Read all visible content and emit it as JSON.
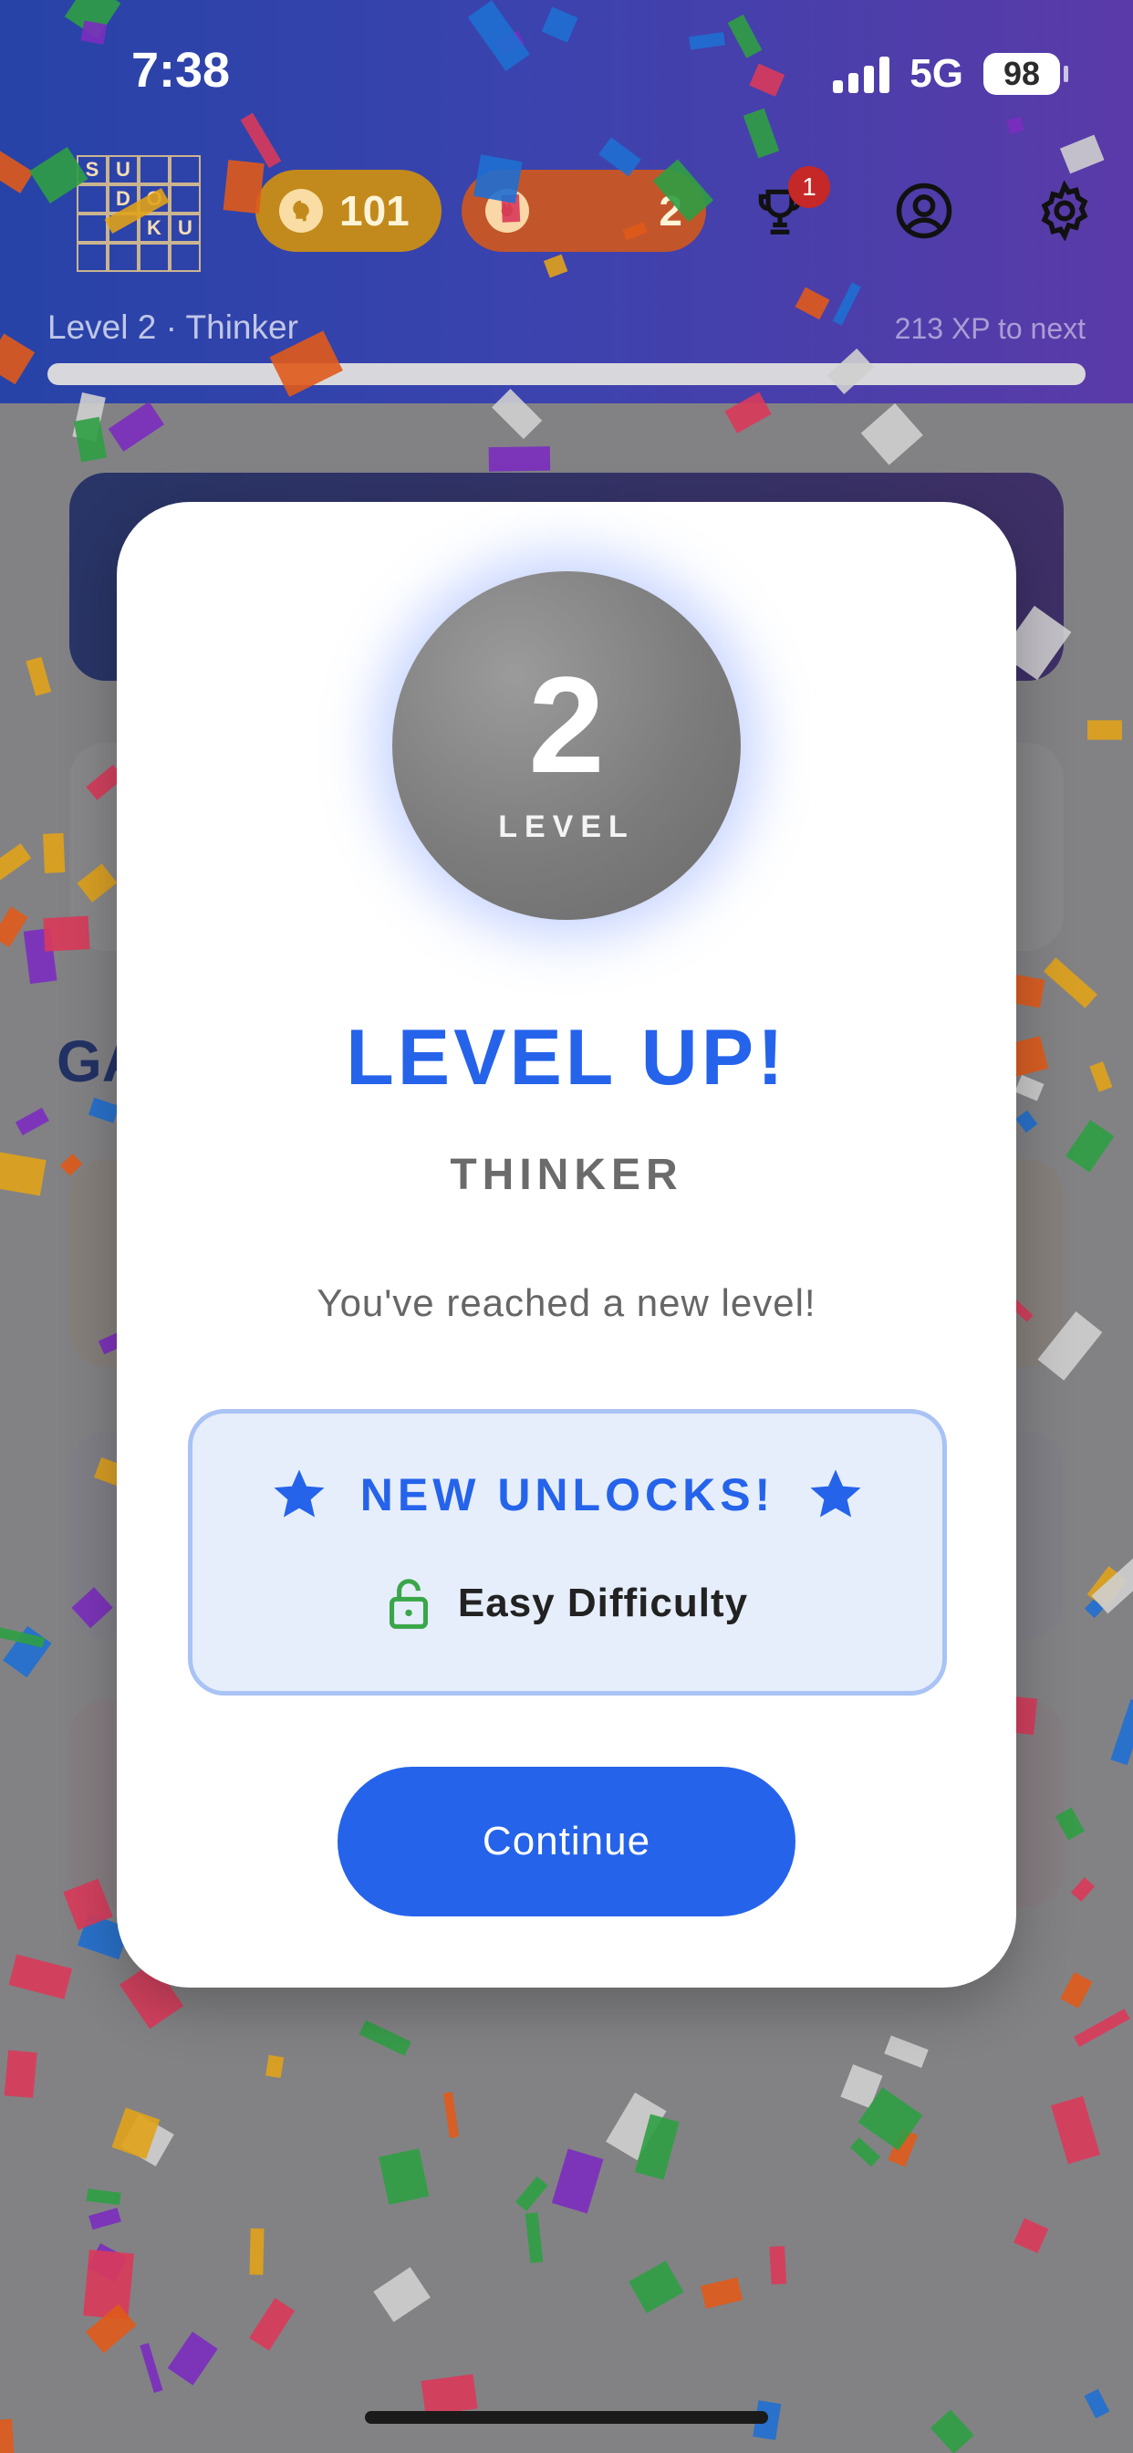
{
  "status_bar": {
    "time": "7:38",
    "network": "5G",
    "battery": "98"
  },
  "header": {
    "logo_letters": [
      "S",
      "U",
      "",
      "",
      "",
      "D",
      "O",
      "",
      "",
      "",
      "K",
      "U",
      "",
      "",
      "",
      ""
    ],
    "brain_points": "101",
    "streak_count": "2",
    "notification_count": "1",
    "level_label": "Level 2 · Thinker",
    "xp_to_next": "213 XP to next",
    "xp_progress": 0.0
  },
  "background": {
    "games_heading": "GA"
  },
  "modal": {
    "level_number": "2",
    "level_word": "LEVEL",
    "title": "LEVEL UP!",
    "rank": "THINKER",
    "message": "You've reached a new level!",
    "unlocks": {
      "heading": "NEW UNLOCKS!",
      "items": [
        {
          "icon": "lock-open-icon",
          "label": "Easy Difficulty"
        }
      ]
    },
    "continue_label": "Continue"
  },
  "colors": {
    "primary": "#2563eb",
    "unlock_bg": "#e6eefc",
    "unlock_border": "#a9c3f5",
    "unlock_icon": "#3aa64a"
  }
}
